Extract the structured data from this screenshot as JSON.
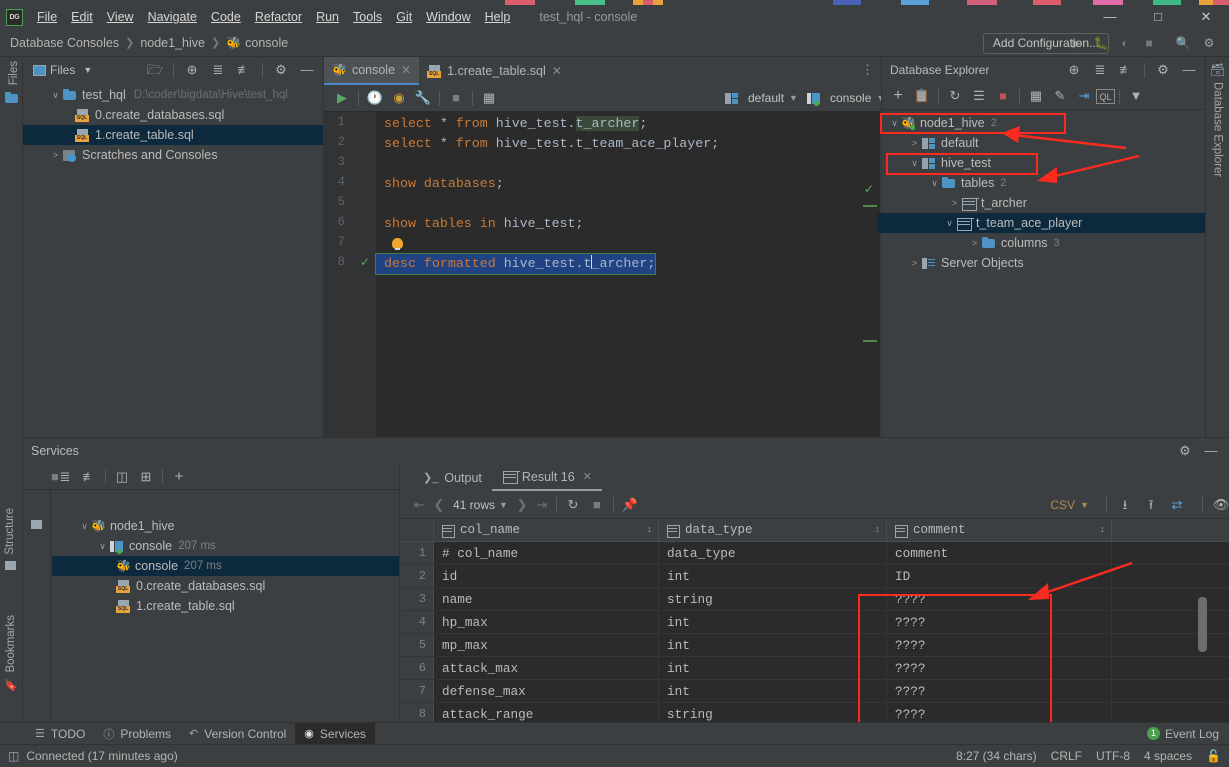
{
  "window": {
    "title": "test_hql - console",
    "logo": "DG",
    "controls": {
      "minimize": "—",
      "maximize": "□",
      "close": "✕"
    }
  },
  "menubar": {
    "items": [
      "File",
      "Edit",
      "View",
      "Navigate",
      "Code",
      "Refactor",
      "Run",
      "Tools",
      "Git",
      "Window",
      "Help"
    ]
  },
  "navbar": {
    "breadcrumbs": [
      "Database Consoles",
      "node1_hive",
      "console"
    ],
    "add_configuration": "Add Configuration...",
    "icons": [
      "run-icon",
      "debug-icon",
      "run-with-coverage-icon",
      "stop-icon",
      "search-icon",
      "settings-icon"
    ]
  },
  "files_panel": {
    "title": "Files",
    "vertical_label": "Files",
    "tree": [
      {
        "indent": 0,
        "arrow": "∨",
        "icon": "folder-icon",
        "label": "test_hql",
        "path": "D:\\coder\\bigdata\\Hive\\test_hql",
        "selected": false
      },
      {
        "indent": 1,
        "arrow": "",
        "icon": "sql-file-icon",
        "label": "0.create_databases.sql",
        "path": "",
        "selected": false
      },
      {
        "indent": 1,
        "arrow": "",
        "icon": "sql-file-icon",
        "label": "1.create_table.sql",
        "path": "",
        "selected": true
      },
      {
        "indent": 0,
        "arrow": ">",
        "icon": "scratches-icon",
        "label": "Scratches and Consoles",
        "path": "",
        "selected": false
      }
    ]
  },
  "editor": {
    "tabs": [
      {
        "label": "console",
        "icon": "hive-icon",
        "active": true
      },
      {
        "label": "1.create_table.sql",
        "icon": "sql-file-icon",
        "active": false
      }
    ],
    "toolbar": {
      "icons": [
        "execute-icon",
        "history-icon",
        "parameters-icon",
        "wrench-icon",
        "stop-icon",
        "table-mode-icon"
      ],
      "schema_combo": "default",
      "session_combo": "console"
    },
    "line_numbers": [
      "1",
      "2",
      "3",
      "4",
      "5",
      "6",
      "7",
      "8"
    ],
    "lines": [
      {
        "n": 1,
        "text": "select * from hive_test.t_archer;"
      },
      {
        "n": 2,
        "text": "select * from hive_test.t_team_ace_player;"
      },
      {
        "n": 3,
        "text": ""
      },
      {
        "n": 4,
        "text": "show databases;"
      },
      {
        "n": 5,
        "text": ""
      },
      {
        "n": 6,
        "text": "show tables in hive_test;"
      },
      {
        "n": 7,
        "text": ""
      },
      {
        "n": 8,
        "text": "desc formatted hive_test.t_archer;"
      }
    ]
  },
  "db_explorer": {
    "title": "Database Explorer",
    "vertical_label": "Database Explorer",
    "toolbar_icons": [
      "add-icon",
      "copy-icon",
      "refresh-icon",
      "sync-icon",
      "stop-icon",
      "table-icon",
      "edit-icon",
      "jump-icon",
      "ql-icon",
      "filter-icon"
    ],
    "header_icons": [
      "locate-icon",
      "expand-all-icon",
      "collapse-all-icon",
      "settings-icon",
      "hide-icon"
    ],
    "tree": [
      {
        "indent": 0,
        "arrow": "∨",
        "icon": "hive-icon",
        "label": "node1_hive",
        "badge": "2",
        "selected": false,
        "highlight": true
      },
      {
        "indent": 1,
        "arrow": ">",
        "icon": "schema-icon",
        "label": "default",
        "badge": "",
        "selected": false,
        "highlight": false
      },
      {
        "indent": 1,
        "arrow": "∨",
        "icon": "schema-icon",
        "label": "hive_test",
        "badge": "",
        "selected": false,
        "highlight": true
      },
      {
        "indent": 2,
        "arrow": "∨",
        "icon": "folder-icon",
        "label": "tables",
        "badge": "2",
        "selected": false,
        "highlight": false
      },
      {
        "indent": 3,
        "arrow": ">",
        "icon": "table-icon",
        "label": "t_archer",
        "badge": "",
        "selected": false,
        "highlight": false
      },
      {
        "indent": 3,
        "arrow": "∨",
        "icon": "table-icon",
        "label": "t_team_ace_player",
        "badge": "",
        "selected": true,
        "highlight": false
      },
      {
        "indent": 4,
        "arrow": ">",
        "icon": "folder-icon",
        "label": "columns",
        "badge": "3",
        "selected": false,
        "highlight": false
      },
      {
        "indent": 1,
        "arrow": ">",
        "icon": "server-objects-icon",
        "label": "Server Objects",
        "badge": "",
        "selected": false,
        "highlight": false
      }
    ]
  },
  "services": {
    "title": "Services",
    "toolbar_icons": [
      "stop-icon",
      "expand-all-icon",
      "collapse-all-icon",
      "group-icon",
      "add-tab-icon",
      "add-icon"
    ],
    "tree": [
      {
        "indent": 0,
        "arrow": "∨",
        "icon": "hive-icon",
        "label": "node1_hive",
        "time": "",
        "selected": false
      },
      {
        "indent": 1,
        "arrow": "∨",
        "icon": "console-icon",
        "label": "console",
        "time": "207 ms",
        "selected": false
      },
      {
        "indent": 2,
        "arrow": "",
        "icon": "hive-icon",
        "label": "console",
        "time": "207 ms",
        "selected": true
      },
      {
        "indent": 2,
        "arrow": "",
        "icon": "sql-file-icon",
        "label": "0.create_databases.sql",
        "time": "",
        "selected": false
      },
      {
        "indent": 2,
        "arrow": "",
        "icon": "sql-file-icon",
        "label": "1.create_table.sql",
        "time": "",
        "selected": false
      }
    ]
  },
  "results": {
    "tabs": [
      {
        "label": "Output",
        "icon": "output-icon",
        "active": false,
        "closable": false
      },
      {
        "label": "Result 16",
        "icon": "table-icon",
        "active": true,
        "closable": true
      }
    ],
    "toolbar": {
      "row_count": "41 rows",
      "nav_icons": [
        "first-page-icon",
        "prev-page-icon",
        "next-page-icon",
        "last-page-icon",
        "refresh-icon",
        "stop-icon",
        "pin-icon"
      ],
      "format": "CSV",
      "right_icons": [
        "download-icon",
        "upload-icon",
        "transpose-icon",
        "view-icon",
        "settings-icon"
      ]
    },
    "columns": [
      "col_name",
      "data_type",
      "comment"
    ],
    "rows": [
      {
        "n": "1",
        "col_name": "# col_name",
        "data_type": "data_type",
        "comment": "comment"
      },
      {
        "n": "2",
        "col_name": "id",
        "data_type": "int",
        "comment": "ID"
      },
      {
        "n": "3",
        "col_name": "name",
        "data_type": "string",
        "comment": "????"
      },
      {
        "n": "4",
        "col_name": "hp_max",
        "data_type": "int",
        "comment": "????"
      },
      {
        "n": "5",
        "col_name": "mp_max",
        "data_type": "int",
        "comment": "????"
      },
      {
        "n": "6",
        "col_name": "attack_max",
        "data_type": "int",
        "comment": "????"
      },
      {
        "n": "7",
        "col_name": "defense_max",
        "data_type": "int",
        "comment": "????"
      },
      {
        "n": "8",
        "col_name": "attack_range",
        "data_type": "string",
        "comment": "????"
      }
    ]
  },
  "bottom_bar": {
    "buttons": [
      {
        "label": "TODO",
        "icon": "todo-icon",
        "active": false
      },
      {
        "label": "Problems",
        "icon": "problems-icon",
        "active": false
      },
      {
        "label": "Version Control",
        "icon": "version-control-icon",
        "active": false
      },
      {
        "label": "Services",
        "icon": "services-icon",
        "active": true
      }
    ],
    "event_log": {
      "label": "Event Log",
      "count": "1"
    }
  },
  "status_bar": {
    "connection": "Connected (17 minutes ago)",
    "caret": "8:27 (34 chars)",
    "line_sep": "CRLF",
    "encoding": "UTF-8",
    "indent": "4 spaces",
    "lock": "lock-icon"
  },
  "side_labels": {
    "structure": "Structure",
    "bookmarks": "Bookmarks"
  },
  "colors": {
    "accent": "#4a88c7",
    "annotation_red": "#ff2a1f",
    "keyword": "#cc7832",
    "identifier": "#a9b7c6",
    "selection": "#214283",
    "tree_selection": "#0d293e",
    "panel_bg": "#3c3f41",
    "editor_bg": "#2b2b2b"
  }
}
